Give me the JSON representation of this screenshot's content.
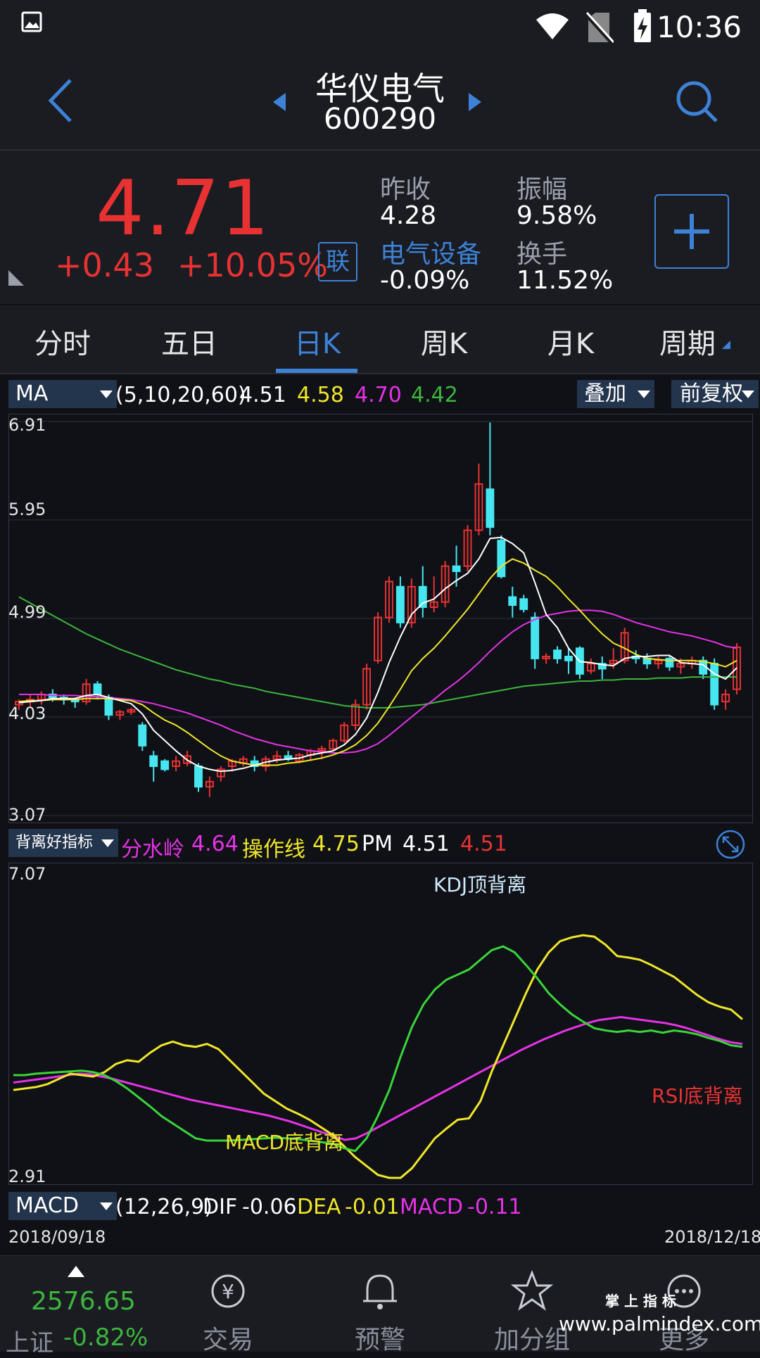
{
  "status_bar": {
    "time": "10:36"
  },
  "header": {
    "stock_name": "华仪电气",
    "stock_code": "600290"
  },
  "quote": {
    "price": "4.71",
    "change": "+0.43",
    "change_pct": "+10.05%",
    "lian_label": "联",
    "prev_close_label": "昨收",
    "prev_close": "4.28",
    "amplitude_label": "振幅",
    "amplitude": "9.58%",
    "sector_label": "电气设备",
    "sector_change": "-0.09%",
    "turnover_label": "换手",
    "turnover": "11.52%"
  },
  "tabs": [
    {
      "label": "分时"
    },
    {
      "label": "五日"
    },
    {
      "label": "日K",
      "active": true
    },
    {
      "label": "周K"
    },
    {
      "label": "月K"
    },
    {
      "label": "周期"
    }
  ],
  "ma_bar": {
    "selector": "MA",
    "params": "(5,10,20,60)",
    "ma5": "4.51",
    "ma10": "4.58",
    "ma20": "4.70",
    "ma60": "4.42",
    "overlay_label": "叠加",
    "adjust_label": "前复权"
  },
  "colors": {
    "up": "#e83232",
    "down": "#46e6f0",
    "ma5": "#ffffff",
    "ma10": "#f0e62a",
    "ma20": "#e632e6",
    "ma60": "#3cb43c",
    "accent": "#3d82d6"
  },
  "kline_axis": {
    "top": "6.91",
    "l2": "5.95",
    "l3": "4.99",
    "l4": "4.03",
    "bottom": "3.07"
  },
  "chart_data": [
    {
      "type": "candlestick",
      "ylim": [
        3.07,
        6.91
      ],
      "series": [
        {
          "name": "K",
          "ohlc": [
            [
              4.15,
              4.2,
              4.1,
              4.18
            ],
            [
              4.18,
              4.25,
              4.12,
              4.2
            ],
            [
              4.2,
              4.28,
              4.15,
              4.25
            ],
            [
              4.25,
              4.3,
              4.18,
              4.22
            ],
            [
              4.22,
              4.25,
              4.15,
              4.2
            ],
            [
              4.2,
              4.22,
              4.12,
              4.18
            ],
            [
              4.18,
              4.4,
              4.15,
              4.35
            ],
            [
              4.35,
              4.38,
              4.2,
              4.25
            ],
            [
              4.22,
              4.25,
              4.0,
              4.05
            ],
            [
              4.05,
              4.1,
              4.0,
              4.08
            ],
            [
              4.08,
              4.12,
              4.05,
              4.1
            ],
            [
              3.95,
              3.98,
              3.7,
              3.75
            ],
            [
              3.65,
              3.7,
              3.4,
              3.55
            ],
            [
              3.6,
              3.62,
              3.5,
              3.52
            ],
            [
              3.55,
              3.65,
              3.5,
              3.6
            ],
            [
              3.58,
              3.7,
              3.55,
              3.65
            ],
            [
              3.55,
              3.58,
              3.3,
              3.35
            ],
            [
              3.35,
              3.45,
              3.25,
              3.4
            ],
            [
              3.45,
              3.55,
              3.4,
              3.52
            ],
            [
              3.55,
              3.62,
              3.5,
              3.6
            ],
            [
              3.58,
              3.65,
              3.55,
              3.62
            ],
            [
              3.6,
              3.65,
              3.5,
              3.55
            ],
            [
              3.55,
              3.65,
              3.5,
              3.62
            ],
            [
              3.62,
              3.7,
              3.58,
              3.65
            ],
            [
              3.65,
              3.7,
              3.6,
              3.62
            ],
            [
              3.6,
              3.68,
              3.58,
              3.66
            ],
            [
              3.66,
              3.72,
              3.6,
              3.7
            ],
            [
              3.7,
              3.75,
              3.62,
              3.72
            ],
            [
              3.72,
              3.82,
              3.7,
              3.8
            ],
            [
              3.8,
              3.98,
              3.78,
              3.95
            ],
            [
              3.95,
              4.2,
              3.9,
              4.15
            ],
            [
              4.15,
              4.55,
              4.1,
              4.5
            ],
            [
              4.58,
              5.05,
              4.55,
              5.0
            ],
            [
              5.0,
              5.4,
              4.95,
              5.35
            ],
            [
              5.3,
              5.4,
              4.9,
              4.95
            ],
            [
              4.95,
              5.38,
              4.9,
              5.3
            ],
            [
              5.3,
              5.5,
              5.0,
              5.1
            ],
            [
              5.1,
              5.4,
              5.05,
              5.15
            ],
            [
              5.15,
              5.55,
              5.1,
              5.5
            ],
            [
              5.5,
              5.7,
              5.3,
              5.45
            ],
            [
              5.5,
              5.9,
              5.45,
              5.85
            ],
            [
              5.85,
              6.5,
              5.8,
              6.3
            ],
            [
              6.25,
              6.9,
              5.8,
              5.88
            ],
            [
              5.75,
              5.8,
              5.38,
              5.4
            ],
            [
              5.2,
              5.3,
              5.0,
              5.12
            ],
            [
              5.18,
              5.22,
              5.05,
              5.08
            ],
            [
              5.0,
              5.05,
              4.5,
              4.6
            ],
            [
              4.6,
              4.65,
              4.55,
              4.62
            ],
            [
              4.68,
              4.72,
              4.55,
              4.6
            ],
            [
              4.62,
              4.7,
              4.45,
              4.58
            ],
            [
              4.7,
              4.72,
              4.4,
              4.45
            ],
            [
              4.48,
              4.6,
              4.45,
              4.55
            ],
            [
              4.55,
              4.62,
              4.4,
              4.5
            ],
            [
              4.55,
              4.7,
              4.5,
              4.58
            ],
            [
              4.58,
              4.9,
              4.55,
              4.85
            ],
            [
              4.62,
              4.68,
              4.55,
              4.6
            ],
            [
              4.6,
              4.65,
              4.5,
              4.55
            ],
            [
              4.55,
              4.62,
              4.5,
              4.58
            ],
            [
              4.6,
              4.62,
              4.48,
              4.52
            ],
            [
              4.52,
              4.6,
              4.45,
              4.55
            ],
            [
              4.55,
              4.62,
              4.5,
              4.58
            ],
            [
              4.58,
              4.62,
              4.4,
              4.45
            ],
            [
              4.55,
              4.6,
              4.1,
              4.15
            ],
            [
              4.18,
              4.3,
              4.1,
              4.25
            ],
            [
              4.3,
              4.75,
              4.25,
              4.71
            ]
          ]
        }
      ],
      "ma5": [
        4.17,
        4.18,
        4.19,
        4.21,
        4.21,
        4.21,
        4.24,
        4.25,
        4.22,
        4.19,
        4.16,
        4.06,
        3.9,
        3.8,
        3.7,
        3.61,
        3.55,
        3.52,
        3.5,
        3.51,
        3.53,
        3.56,
        3.59,
        3.61,
        3.62,
        3.63,
        3.66,
        3.68,
        3.7,
        3.76,
        3.86,
        4.02,
        4.27,
        4.56,
        4.81,
        5.03,
        5.14,
        5.18,
        5.28,
        5.36,
        5.43,
        5.57,
        5.77,
        5.78,
        5.72,
        5.63,
        5.34,
        5.03,
        4.9,
        4.7,
        4.57,
        4.56,
        4.54,
        4.53,
        4.6,
        4.62,
        4.62,
        4.63,
        4.63,
        4.56,
        4.55,
        4.54,
        4.45,
        4.4,
        4.51
      ],
      "ma10": [
        4.18,
        4.19,
        4.19,
        4.2,
        4.2,
        4.2,
        4.21,
        4.21,
        4.21,
        4.2,
        4.19,
        4.15,
        4.07,
        4.0,
        3.95,
        3.88,
        3.8,
        3.72,
        3.65,
        3.6,
        3.58,
        3.56,
        3.56,
        3.56,
        3.58,
        3.59,
        3.61,
        3.63,
        3.66,
        3.7,
        3.76,
        3.85,
        3.97,
        4.13,
        4.3,
        4.48,
        4.6,
        4.7,
        4.82,
        4.95,
        5.08,
        5.23,
        5.38,
        5.5,
        5.57,
        5.53,
        5.46,
        5.4,
        5.3,
        5.18,
        5.07,
        4.95,
        4.84,
        4.75,
        4.7,
        4.64,
        4.6,
        4.59,
        4.58,
        4.58,
        4.58,
        4.57,
        4.55,
        4.52,
        4.58
      ],
      "ma20": [
        4.25,
        4.25,
        4.25,
        4.24,
        4.24,
        4.24,
        4.23,
        4.23,
        4.22,
        4.21,
        4.2,
        4.18,
        4.16,
        4.13,
        4.1,
        4.07,
        4.03,
        3.99,
        3.95,
        3.9,
        3.86,
        3.82,
        3.79,
        3.76,
        3.74,
        3.72,
        3.7,
        3.69,
        3.68,
        3.68,
        3.69,
        3.72,
        3.77,
        3.85,
        3.94,
        4.03,
        4.12,
        4.2,
        4.29,
        4.37,
        4.46,
        4.56,
        4.67,
        4.77,
        4.86,
        4.93,
        4.98,
        5.02,
        5.04,
        5.06,
        5.07,
        5.07,
        5.06,
        5.03,
        4.99,
        4.95,
        4.92,
        4.89,
        4.86,
        4.84,
        4.82,
        4.79,
        4.76,
        4.72,
        4.7
      ],
      "ma60": [
        5.2,
        5.14,
        5.08,
        5.02,
        4.96,
        4.9,
        4.84,
        4.79,
        4.74,
        4.69,
        4.65,
        4.61,
        4.57,
        4.53,
        4.49,
        4.46,
        4.43,
        4.4,
        4.38,
        4.35,
        4.33,
        4.31,
        4.28,
        4.26,
        4.24,
        4.22,
        4.2,
        4.18,
        4.16,
        4.14,
        4.13,
        4.12,
        4.12,
        4.12,
        4.13,
        4.14,
        4.15,
        4.17,
        4.19,
        4.21,
        4.23,
        4.25,
        4.27,
        4.29,
        4.31,
        4.33,
        4.34,
        4.35,
        4.36,
        4.37,
        4.38,
        4.38,
        4.39,
        4.39,
        4.4,
        4.4,
        4.4,
        4.41,
        4.41,
        4.41,
        4.42,
        4.42,
        4.42,
        4.42,
        4.42
      ]
    },
    {
      "type": "line",
      "ylim": [
        2.91,
        7.07
      ],
      "series": [
        {
          "name": "分水岭",
          "values": [
            4.2,
            4.22,
            4.24,
            4.26,
            4.28,
            4.3,
            4.32,
            4.31,
            4.28,
            4.25,
            4.21,
            4.17,
            4.13,
            4.09,
            4.05,
            4.01,
            3.97,
            3.94,
            3.91,
            3.88,
            3.85,
            3.82,
            3.79,
            3.76,
            3.72,
            3.68,
            3.63,
            3.58,
            3.53,
            3.48,
            3.43,
            3.45,
            3.52,
            3.6,
            3.68,
            3.76,
            3.84,
            3.92,
            4.0,
            4.08,
            4.16,
            4.24,
            4.32,
            4.4,
            4.48,
            4.56,
            4.64,
            4.71,
            4.78,
            4.84,
            4.9,
            4.95,
            5.0,
            5.04,
            5.06,
            5.08,
            5.06,
            5.04,
            5.02,
            5.0,
            4.97,
            4.93,
            4.88,
            4.83,
            4.78,
            4.74,
            4.72
          ]
        },
        {
          "name": "操作线",
          "values": [
            4.1,
            4.12,
            4.14,
            4.18,
            4.25,
            4.32,
            4.3,
            4.28,
            4.34,
            4.45,
            4.5,
            4.48,
            4.6,
            4.7,
            4.75,
            4.7,
            4.68,
            4.72,
            4.65,
            4.5,
            4.35,
            4.2,
            4.05,
            3.95,
            3.85,
            3.78,
            3.7,
            3.6,
            3.5,
            3.35,
            3.2,
            3.08,
            2.96,
            2.92,
            2.92,
            3.05,
            3.25,
            3.45,
            3.58,
            3.7,
            3.72,
            3.95,
            4.35,
            4.7,
            5.05,
            5.4,
            5.72,
            5.95,
            6.1,
            6.15,
            6.18,
            6.16,
            6.05,
            5.9,
            5.88,
            5.85,
            5.78,
            5.7,
            5.62,
            5.5,
            5.38,
            5.28,
            5.22,
            5.18,
            5.05
          ]
        },
        {
          "name": "PM",
          "values": [
            4.3,
            4.3,
            4.32,
            4.33,
            4.34,
            4.35,
            4.36,
            4.34,
            4.3,
            4.22,
            4.12,
            4.0,
            3.88,
            3.75,
            3.65,
            3.55,
            3.45,
            3.42,
            3.42,
            3.42,
            3.43,
            3.44,
            3.45,
            3.46,
            3.45,
            3.44,
            3.42,
            3.4,
            3.38,
            3.32,
            3.28,
            3.45,
            3.75,
            4.1,
            4.55,
            4.95,
            5.25,
            5.45,
            5.58,
            5.65,
            5.72,
            5.85,
            5.98,
            6.03,
            5.95,
            5.78,
            5.6,
            5.4,
            5.25,
            5.12,
            5.02,
            4.93,
            4.9,
            4.88,
            4.9,
            4.88,
            4.9,
            4.87,
            4.9,
            4.88,
            4.85,
            4.8,
            4.76,
            4.7,
            4.68
          ]
        }
      ],
      "annotations": [
        "KDJ顶背离",
        "MACD底背离",
        "RSI底背离"
      ]
    }
  ],
  "indicator_bar": {
    "selector": "背离好指标",
    "name1": "分水岭",
    "val1": "4.64",
    "name2": "操作线",
    "val2": "4.75",
    "name3": "PM",
    "val3": "4.51",
    "val4": "4.51"
  },
  "indicator_axis": {
    "top": "7.07",
    "bottom": "2.91"
  },
  "annotations": {
    "kdj": "KDJ顶背离",
    "macd": "MACD底背离",
    "rsi": "RSI底背离"
  },
  "macd_bar": {
    "selector": "MACD",
    "params": "(12,26,9)",
    "dif_label": "DIF",
    "dif": "-0.06",
    "dea_label": "DEA",
    "dea": "-0.01",
    "macd_label": "MACD",
    "macd": "-0.11"
  },
  "dates": {
    "start": "2018/09/18",
    "end": "2018/12/18"
  },
  "bottom_nav": {
    "index_value": "2576.65",
    "index_name": "上证",
    "index_change": "-0.82%",
    "items": [
      {
        "label": "交易"
      },
      {
        "label": "预警"
      },
      {
        "label": "加分组"
      },
      {
        "label": "更多"
      }
    ]
  },
  "watermark": {
    "line1": "掌 上 指 标",
    "line2": "www.palmindex.com"
  }
}
